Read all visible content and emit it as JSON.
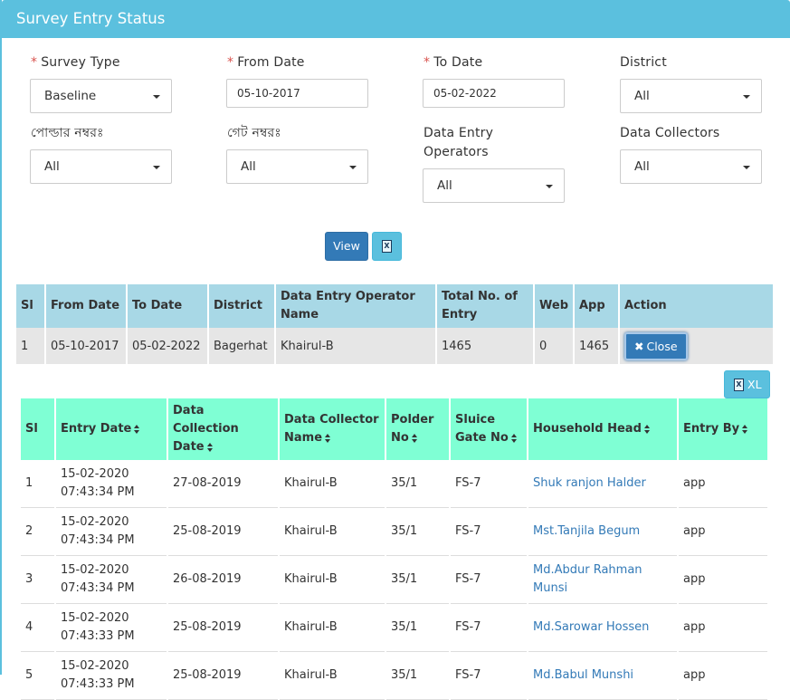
{
  "panel": {
    "title": "Survey Entry Status"
  },
  "filters": {
    "survey_type": {
      "label": "Survey Type",
      "value": "Baseline"
    },
    "from_date": {
      "label": "From Date",
      "value": "05-10-2017"
    },
    "to_date": {
      "label": "To Date",
      "value": "05-02-2022"
    },
    "district": {
      "label": "District",
      "value": "All"
    },
    "polder": {
      "label": "পোল্ডার নম্বরঃ",
      "value": "All"
    },
    "gate": {
      "label": "গেট নম্বরঃ",
      "value": "All"
    },
    "operators": {
      "label_line1": "Data Entry",
      "label_line2": "Operators",
      "value": "All"
    },
    "collectors": {
      "label": "Data Collectors",
      "value": "All"
    },
    "required_mark": "*"
  },
  "actions": {
    "view_label": "View",
    "excel_icon_text": "X",
    "xl_label": "XL",
    "close_label": "Close"
  },
  "summary": {
    "headers": [
      "Sl",
      "From Date",
      "To Date",
      "District",
      "Data Entry Operator Name",
      "Total No. of Entry",
      "Web",
      "App",
      "Action"
    ],
    "row": [
      "1",
      "05-10-2017",
      "05-02-2022",
      "Bagerhat",
      "Khairul-B",
      "1465",
      "0",
      "1465"
    ]
  },
  "details": {
    "headers": [
      "Sl",
      "Entry Date",
      "Data Collection Date",
      "Data Collector Name",
      "Polder No",
      "Sluice Gate No",
      "Household Head",
      "Entry By"
    ],
    "rows": [
      [
        "1",
        "15-02-2020 07:43:34 PM",
        "27-08-2019",
        "Khairul-B",
        "35/1",
        "FS-7",
        "Shuk ranjon Halder",
        "app"
      ],
      [
        "2",
        "15-02-2020 07:43:34 PM",
        "25-08-2019",
        "Khairul-B",
        "35/1",
        "FS-7",
        "Mst.Tanjila Begum",
        "app"
      ],
      [
        "3",
        "15-02-2020 07:43:34 PM",
        "26-08-2019",
        "Khairul-B",
        "35/1",
        "FS-7",
        "Md.Abdur Rahman Munsi",
        "app"
      ],
      [
        "4",
        "15-02-2020 07:43:33 PM",
        "25-08-2019",
        "Khairul-B",
        "35/1",
        "FS-7",
        "Md.Sarowar Hossen",
        "app"
      ],
      [
        "5",
        "15-02-2020 07:43:33 PM",
        "25-08-2019",
        "Khairul-B",
        "35/1",
        "FS-7",
        "Md.Babul Munshi",
        "app"
      ]
    ]
  }
}
